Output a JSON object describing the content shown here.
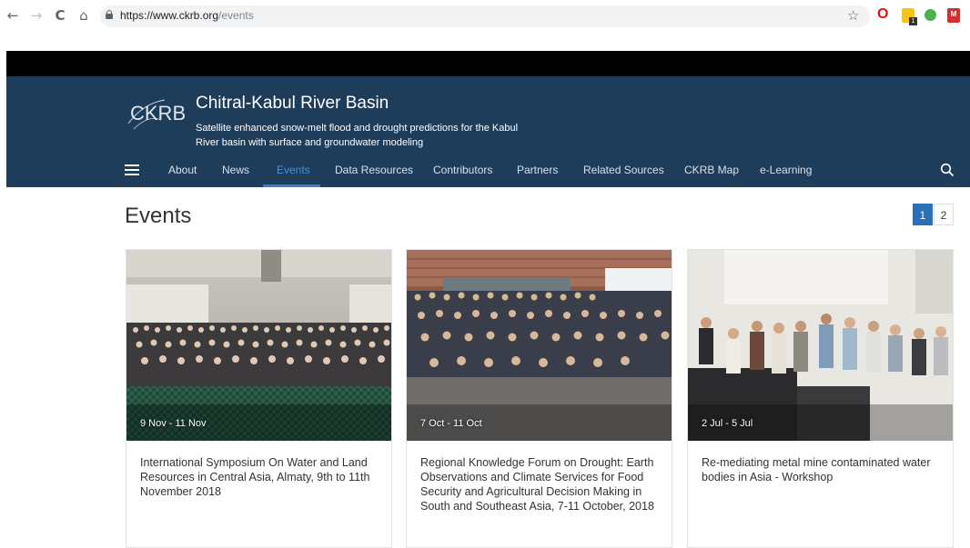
{
  "browser": {
    "url_host": "https://www.ckrb.org",
    "url_path": "/events",
    "back_icon": "←",
    "forward_icon": "→",
    "reload_icon": "C",
    "home_icon": "⌂",
    "star_icon": "☆",
    "opera_letter": "O",
    "ext_badge": "1",
    "ext_red_label": "M"
  },
  "site": {
    "logo_text": "CKRB",
    "title": "Chitral-Kabul River Basin",
    "tagline": "Satellite enhanced snow-melt flood and drought predictions for the Kabul River basin with surface and groundwater modeling"
  },
  "nav": {
    "items": [
      "About",
      "News",
      "Events",
      "Data Resources",
      "Contributors",
      "Partners",
      "Related Sources",
      "CKRB Map",
      "e-Learning"
    ],
    "active": "Events"
  },
  "page": {
    "title": "Events",
    "pagination": [
      "1",
      "2"
    ],
    "current_page": "1"
  },
  "events": [
    {
      "date": "9 Nov - 11 Nov",
      "title": "International Symposium On Water and Land Resources in Central Asia, Almaty, 9th to 11th November 2018"
    },
    {
      "date": "7 Oct - 11 Oct",
      "title": "Regional Knowledge Forum on Drought: Earth Observations and Climate Services for Food Security and Agricultural Decision Making in South and Southeast Asia, 7-11 October, 2018"
    },
    {
      "date": "2 Jul - 5 Jul",
      "title": "Re-mediating metal mine contaminated water bodies in Asia - Workshop"
    }
  ],
  "colors": {
    "header_bg": "#1d3d5b",
    "nav_active": "#4a90d9",
    "pager_active": "#2a6fba"
  }
}
